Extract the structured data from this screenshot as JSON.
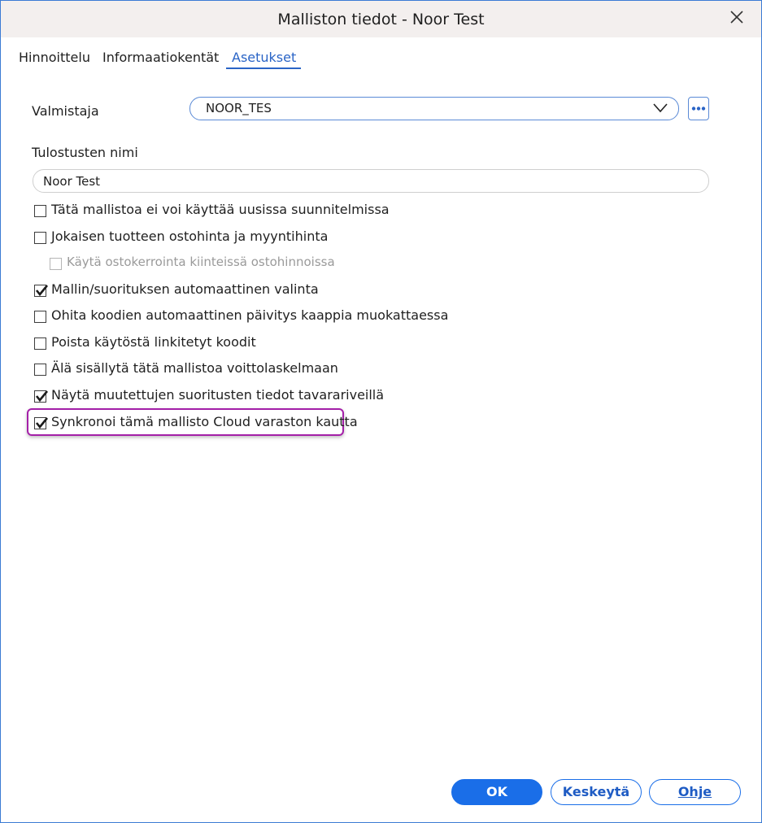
{
  "window": {
    "title": "Malliston tiedot - Noor Test"
  },
  "tabs": [
    {
      "label": "Hinnoittelu",
      "active": false
    },
    {
      "label": "Informaatiokentät",
      "active": false
    },
    {
      "label": "Asetukset",
      "active": true
    }
  ],
  "form": {
    "manufacturer_label": "Valmistaja",
    "manufacturer_value": "NOOR_TES",
    "print_name_label": "Tulostusten nimi",
    "print_name_value": "Noor Test"
  },
  "checkboxes": [
    {
      "label": "Tätä mallistoa ei voi käyttää uusissa suunnitelmissa",
      "checked": false,
      "disabled": false
    },
    {
      "label": "Jokaisen tuotteen ostohinta ja myyntihinta",
      "checked": false,
      "disabled": false
    },
    {
      "label": "Käytä ostokerrointa kiinteissä ostohinnoissa",
      "checked": false,
      "disabled": true
    },
    {
      "label": "Mallin/suorituksen automaattinen valinta",
      "checked": true,
      "disabled": false
    },
    {
      "label": "Ohita koodien automaattinen päivitys kaappia muokattaessa",
      "checked": false,
      "disabled": false
    },
    {
      "label": "Poista käytöstä linkitetyt koodit",
      "checked": false,
      "disabled": false
    },
    {
      "label": "Älä sisällytä tätä mallistoa voittolaskelmaan",
      "checked": false,
      "disabled": false
    },
    {
      "label": "Näytä muutettujen suoritusten tiedot tavarariveillä",
      "checked": true,
      "disabled": false
    },
    {
      "label": "Synkronoi tämä mallisto Cloud varaston kautta",
      "checked": true,
      "disabled": false
    }
  ],
  "buttons": {
    "ok": "OK",
    "cancel": "Keskeytä",
    "help": "Ohje"
  },
  "colors": {
    "accent": "#1a6ee8",
    "highlight": "#a420a8",
    "titlebar": "#f3efee"
  }
}
